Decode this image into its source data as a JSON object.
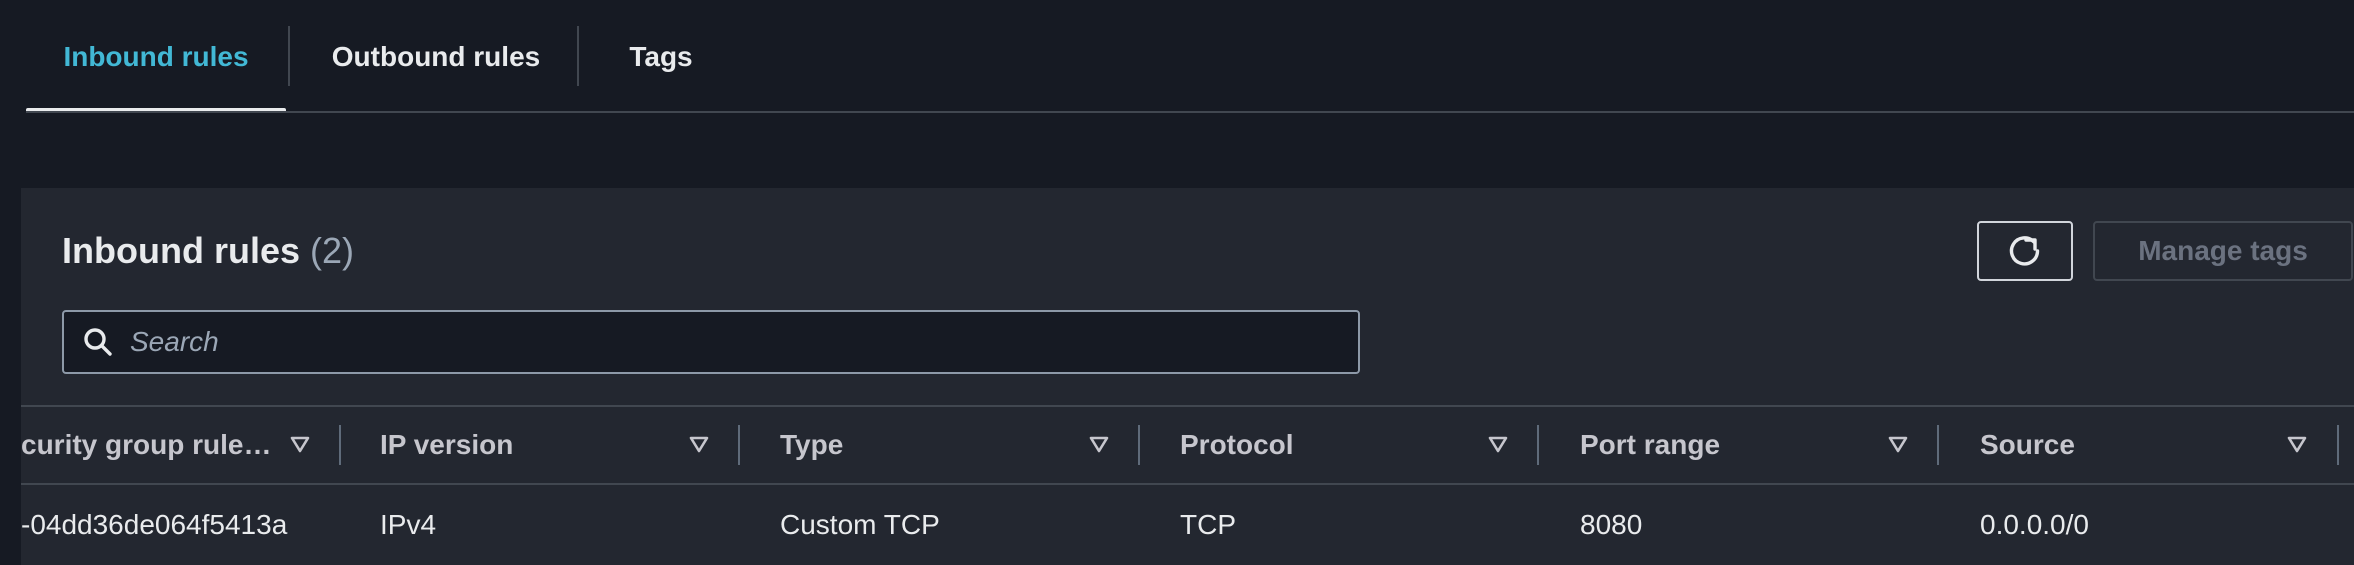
{
  "tabs": [
    {
      "label": "Inbound rules",
      "active": true
    },
    {
      "label": "Outbound rules",
      "active": false
    },
    {
      "label": "Tags",
      "active": false
    }
  ],
  "panel": {
    "title": "Inbound rules",
    "count": "(2)",
    "refresh_icon": "refresh-icon",
    "manage_tags_label": "Manage tags",
    "search": {
      "placeholder": "Search",
      "value": "",
      "icon": "search-icon"
    }
  },
  "table": {
    "columns": [
      {
        "label": "curity group rule…",
        "sort_icon": "sort-down-icon"
      },
      {
        "label": "IP version",
        "sort_icon": "sort-down-icon"
      },
      {
        "label": "Type",
        "sort_icon": "sort-down-icon"
      },
      {
        "label": "Protocol",
        "sort_icon": "sort-down-icon"
      },
      {
        "label": "Port range",
        "sort_icon": "sort-down-icon"
      },
      {
        "label": "Source",
        "sort_icon": "sort-down-icon"
      }
    ],
    "rows": [
      {
        "rule_id": "-04dd36de064f5413a",
        "ip_version": "IPv4",
        "type": "Custom TCP",
        "protocol": "TCP",
        "port_range": "8080",
        "source": "0.0.0.0/0"
      }
    ]
  },
  "colors": {
    "background": "#161a23",
    "panel": "#232730",
    "accent": "#42b8d5",
    "text": "#e9ebed",
    "muted": "#9ba7b6"
  }
}
